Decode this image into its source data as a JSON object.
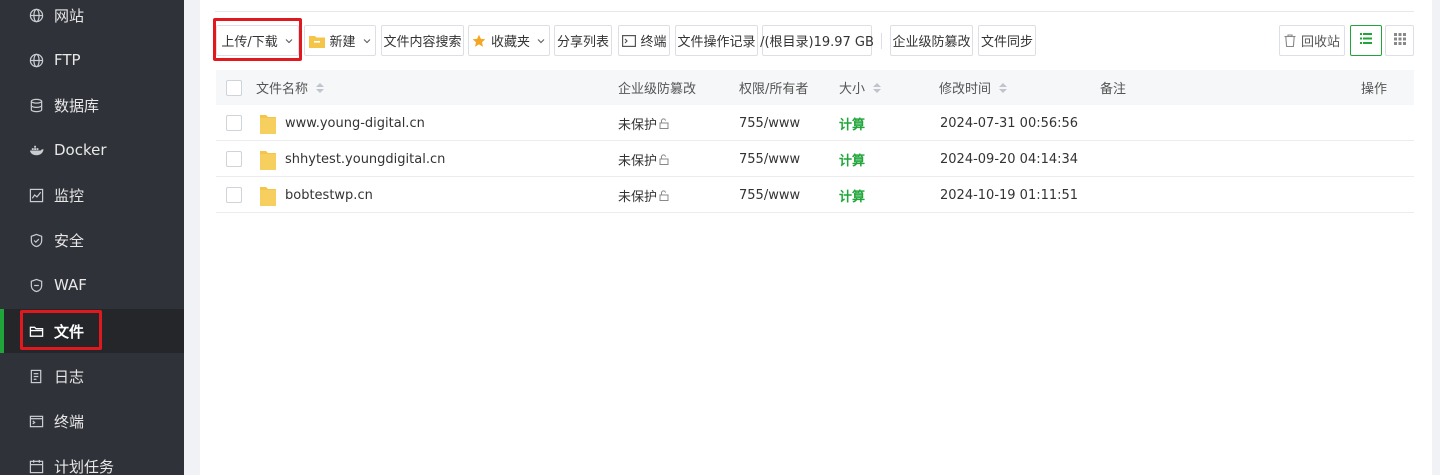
{
  "sidebar": {
    "items": [
      {
        "label": "网站",
        "icon": "globe-icon"
      },
      {
        "label": "FTP",
        "icon": "globe-icon"
      },
      {
        "label": "数据库",
        "icon": "database-icon"
      },
      {
        "label": "Docker",
        "icon": "docker-icon"
      },
      {
        "label": "监控",
        "icon": "monitor-chart-icon"
      },
      {
        "label": "安全",
        "icon": "shield-icon"
      },
      {
        "label": "WAF",
        "icon": "waf-shield-icon"
      },
      {
        "label": "文件",
        "icon": "folder-icon",
        "active": true
      },
      {
        "label": "日志",
        "icon": "log-icon"
      },
      {
        "label": "终端",
        "icon": "terminal-icon"
      },
      {
        "label": "计划任务",
        "icon": "calendar-icon"
      }
    ]
  },
  "toolbar": {
    "upload_download": "上传/下载",
    "new": "新建",
    "content_search": "文件内容搜索",
    "favorites": "收藏夹",
    "share_list": "分享列表",
    "terminal": "终端",
    "operation_log": "文件操作记录",
    "disk_info": "/(根目录)19.97 GB",
    "enterprise_tamper": "企业级防篡改",
    "file_sync": "文件同步",
    "recycle_bin": "回收站"
  },
  "table": {
    "headers": {
      "name": "文件名称",
      "tamper": "企业级防篡改",
      "perm": "权限/所有者",
      "size": "大小",
      "mtime": "修改时间",
      "note": "备注",
      "ops": "操作"
    },
    "rows": [
      {
        "name": "www.young-digital.cn",
        "tamper": "未保护",
        "perm": "755/www",
        "size": "计算",
        "mtime": "2024-07-31 00:56:56"
      },
      {
        "name": "shhytest.youngdigital.cn",
        "tamper": "未保护",
        "perm": "755/www",
        "size": "计算",
        "mtime": "2024-09-20 04:14:34"
      },
      {
        "name": "bobtestwp.cn",
        "tamper": "未保护",
        "perm": "755/www",
        "size": "计算",
        "mtime": "2024-10-19 01:11:51"
      }
    ]
  },
  "colors": {
    "accent": "#20a53a",
    "highlight": "#e0191f",
    "sidebar_bg": "#2f3238",
    "folder": "#f5c54a"
  }
}
